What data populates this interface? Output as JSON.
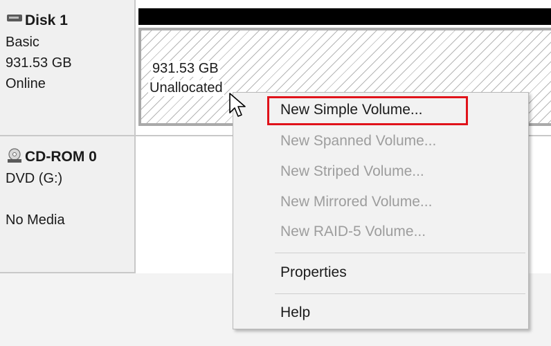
{
  "disks": [
    {
      "name": "Disk 1",
      "type": "Basic",
      "size": "931.53 GB",
      "status": "Online",
      "icon": "hard-disk-icon",
      "partition": {
        "size": "931.53 GB",
        "label": "Unallocated"
      }
    },
    {
      "name": "CD-ROM 0",
      "type": "DVD (G:)",
      "status": "No Media",
      "icon": "cd-rom-icon"
    }
  ],
  "context_menu": {
    "items": [
      {
        "label": "New Simple Volume...",
        "enabled": true,
        "highlighted": true
      },
      {
        "label": "New Spanned Volume...",
        "enabled": false
      },
      {
        "label": "New Striped Volume...",
        "enabled": false
      },
      {
        "label": "New Mirrored Volume...",
        "enabled": false
      },
      {
        "label": "New RAID-5 Volume...",
        "enabled": false
      },
      {
        "label": "Properties",
        "enabled": true
      },
      {
        "label": "Help",
        "enabled": true
      }
    ]
  },
  "colors": {
    "highlight_box": "#e0121a",
    "disabled_text": "#9d9d9d",
    "partition_header": "#000000"
  }
}
